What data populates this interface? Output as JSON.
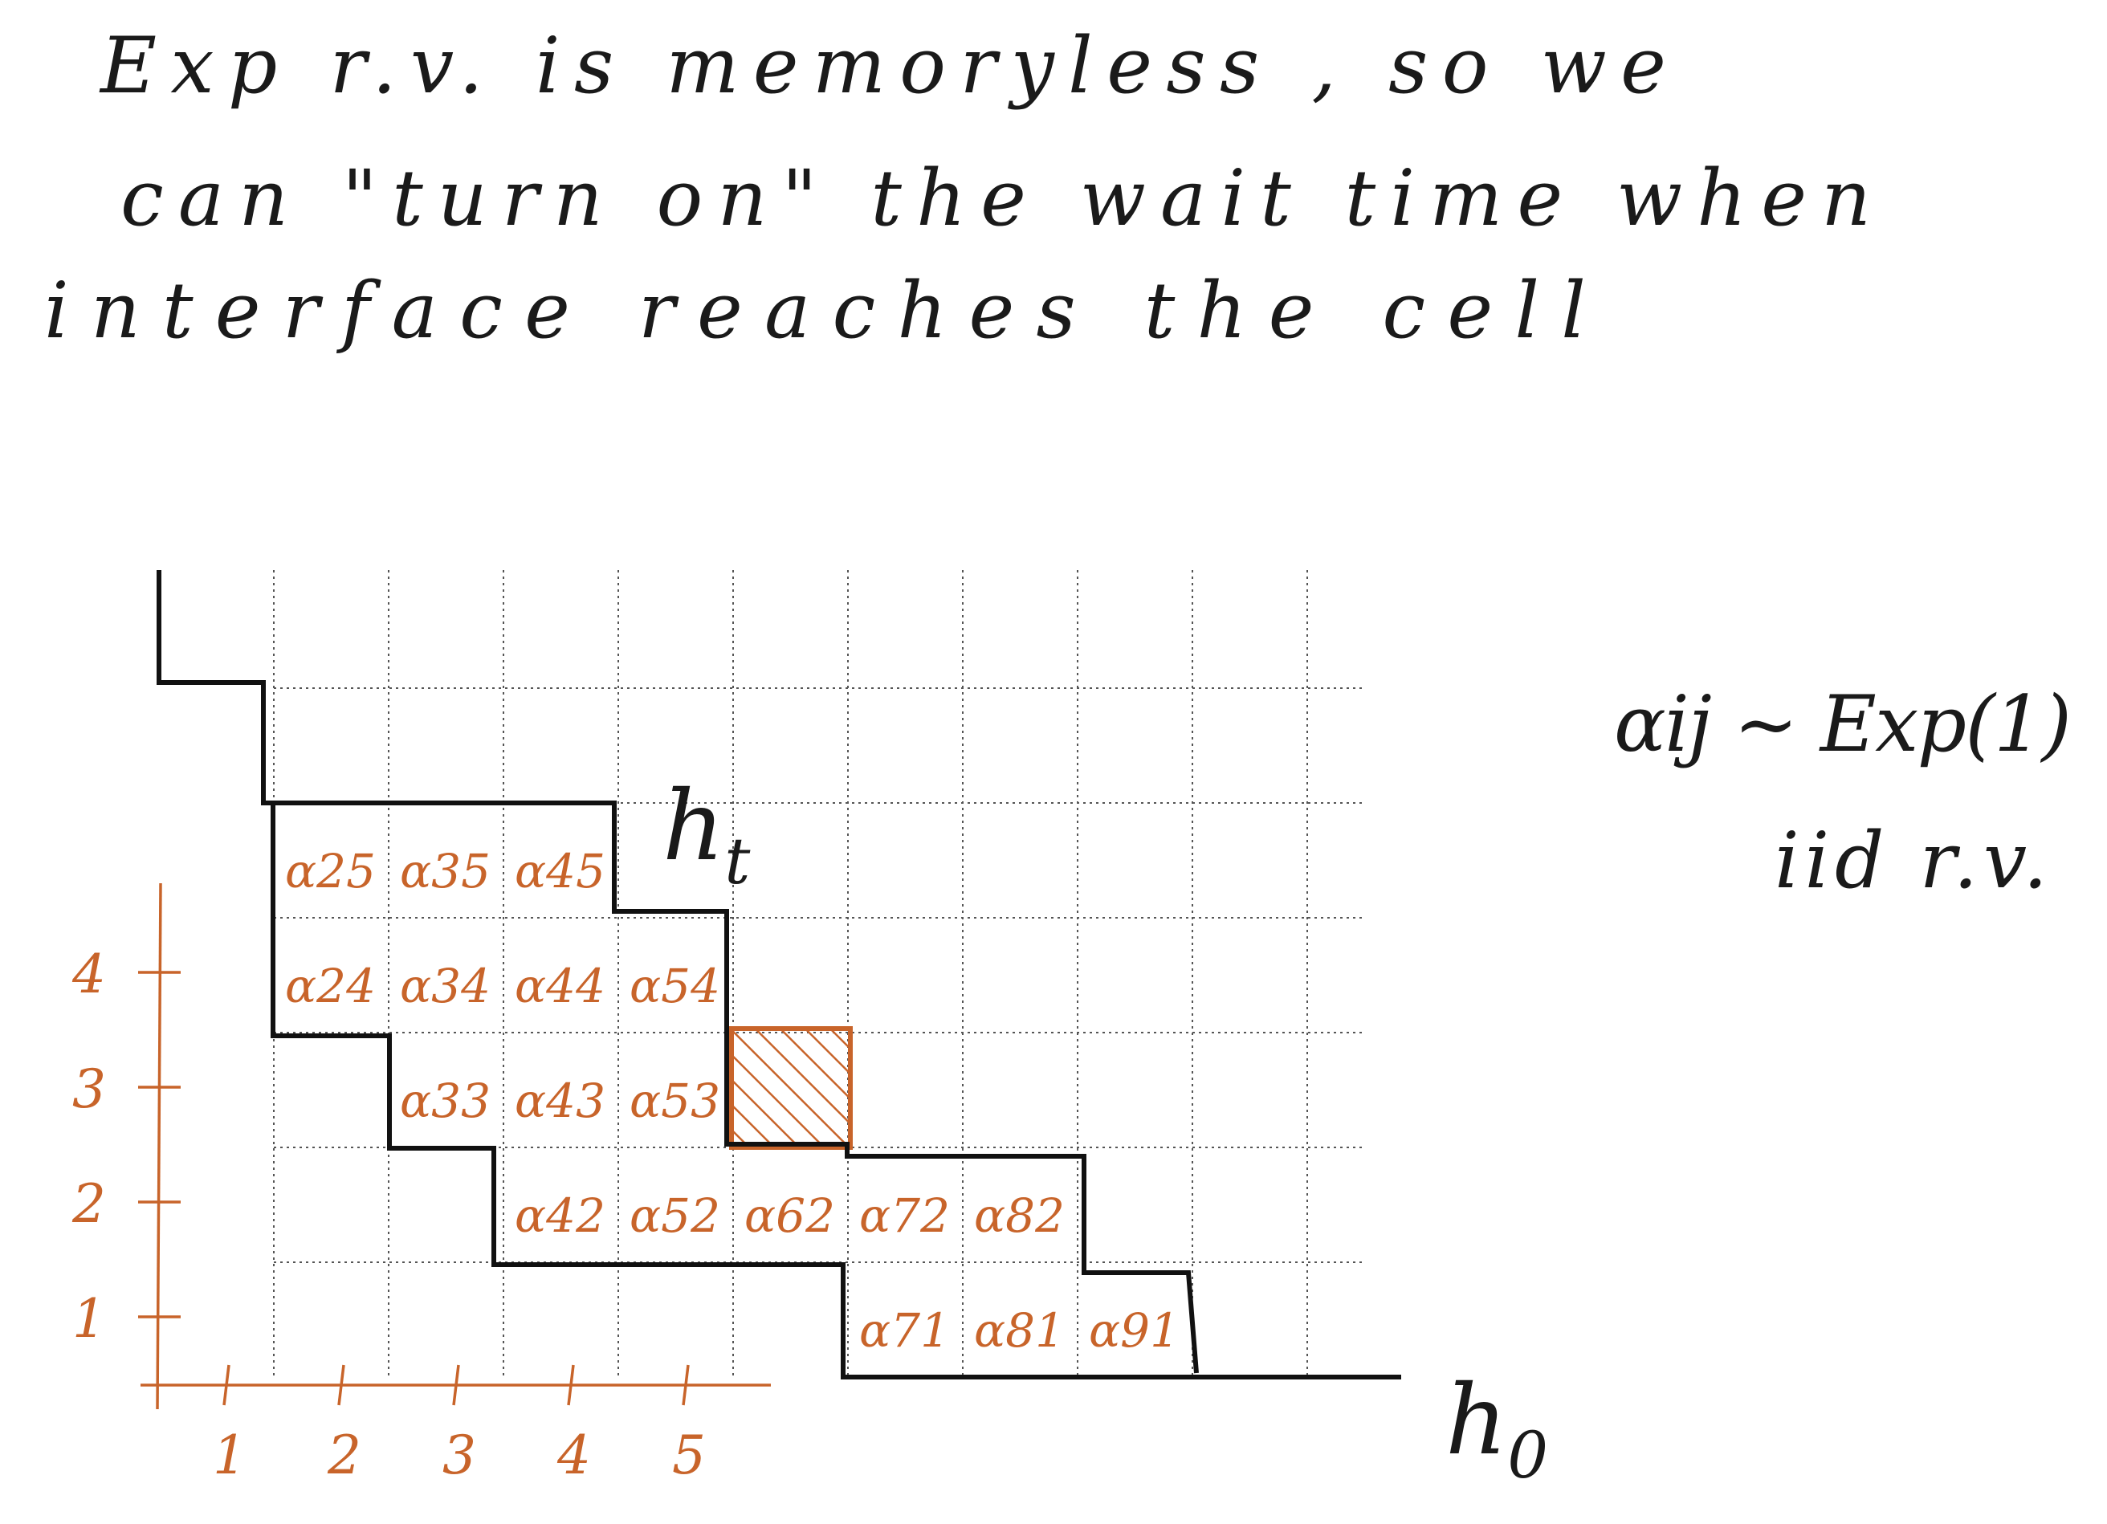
{
  "notes": {
    "line1": "Exp r.v. is memoryless , so we",
    "line2": "can \"turn on\" the wait time when",
    "line3": "interface reaches the cell"
  },
  "labels": {
    "h_t": "h",
    "h_t_sub": "t",
    "h_0": "h",
    "h_0_sub": "0",
    "dist": "αij ~ Exp(1)",
    "iid": "iid r.v."
  },
  "cells": [
    {
      "label": "α25",
      "col": 1,
      "row": 5
    },
    {
      "label": "α35",
      "col": 2,
      "row": 5
    },
    {
      "label": "α45",
      "col": 3,
      "row": 5
    },
    {
      "label": "α24",
      "col": 1,
      "row": 4
    },
    {
      "label": "α34",
      "col": 2,
      "row": 4
    },
    {
      "label": "α44",
      "col": 3,
      "row": 4
    },
    {
      "label": "α54",
      "col": 4,
      "row": 4
    },
    {
      "label": "α33",
      "col": 2,
      "row": 3
    },
    {
      "label": "α43",
      "col": 3,
      "row": 3
    },
    {
      "label": "α53",
      "col": 4,
      "row": 3
    },
    {
      "label": "α42",
      "col": 3,
      "row": 2
    },
    {
      "label": "α52",
      "col": 4,
      "row": 2
    },
    {
      "label": "α62",
      "col": 5,
      "row": 2
    },
    {
      "label": "α72",
      "col": 6,
      "row": 2
    },
    {
      "label": "α82",
      "col": 7,
      "row": 2
    },
    {
      "label": "α71",
      "col": 6,
      "row": 1
    },
    {
      "label": "α81",
      "col": 7,
      "row": 1
    },
    {
      "label": "α91",
      "col": 8,
      "row": 1
    }
  ],
  "hatched_cell": {
    "col": 5,
    "row": 3
  },
  "y_ticks": [
    "1",
    "2",
    "3",
    "4"
  ],
  "x_ticks": [
    "1",
    "2",
    "3",
    "4",
    "5"
  ],
  "colors": {
    "ink": "#111111",
    "accent": "#c8642a",
    "grid": "#555555"
  }
}
